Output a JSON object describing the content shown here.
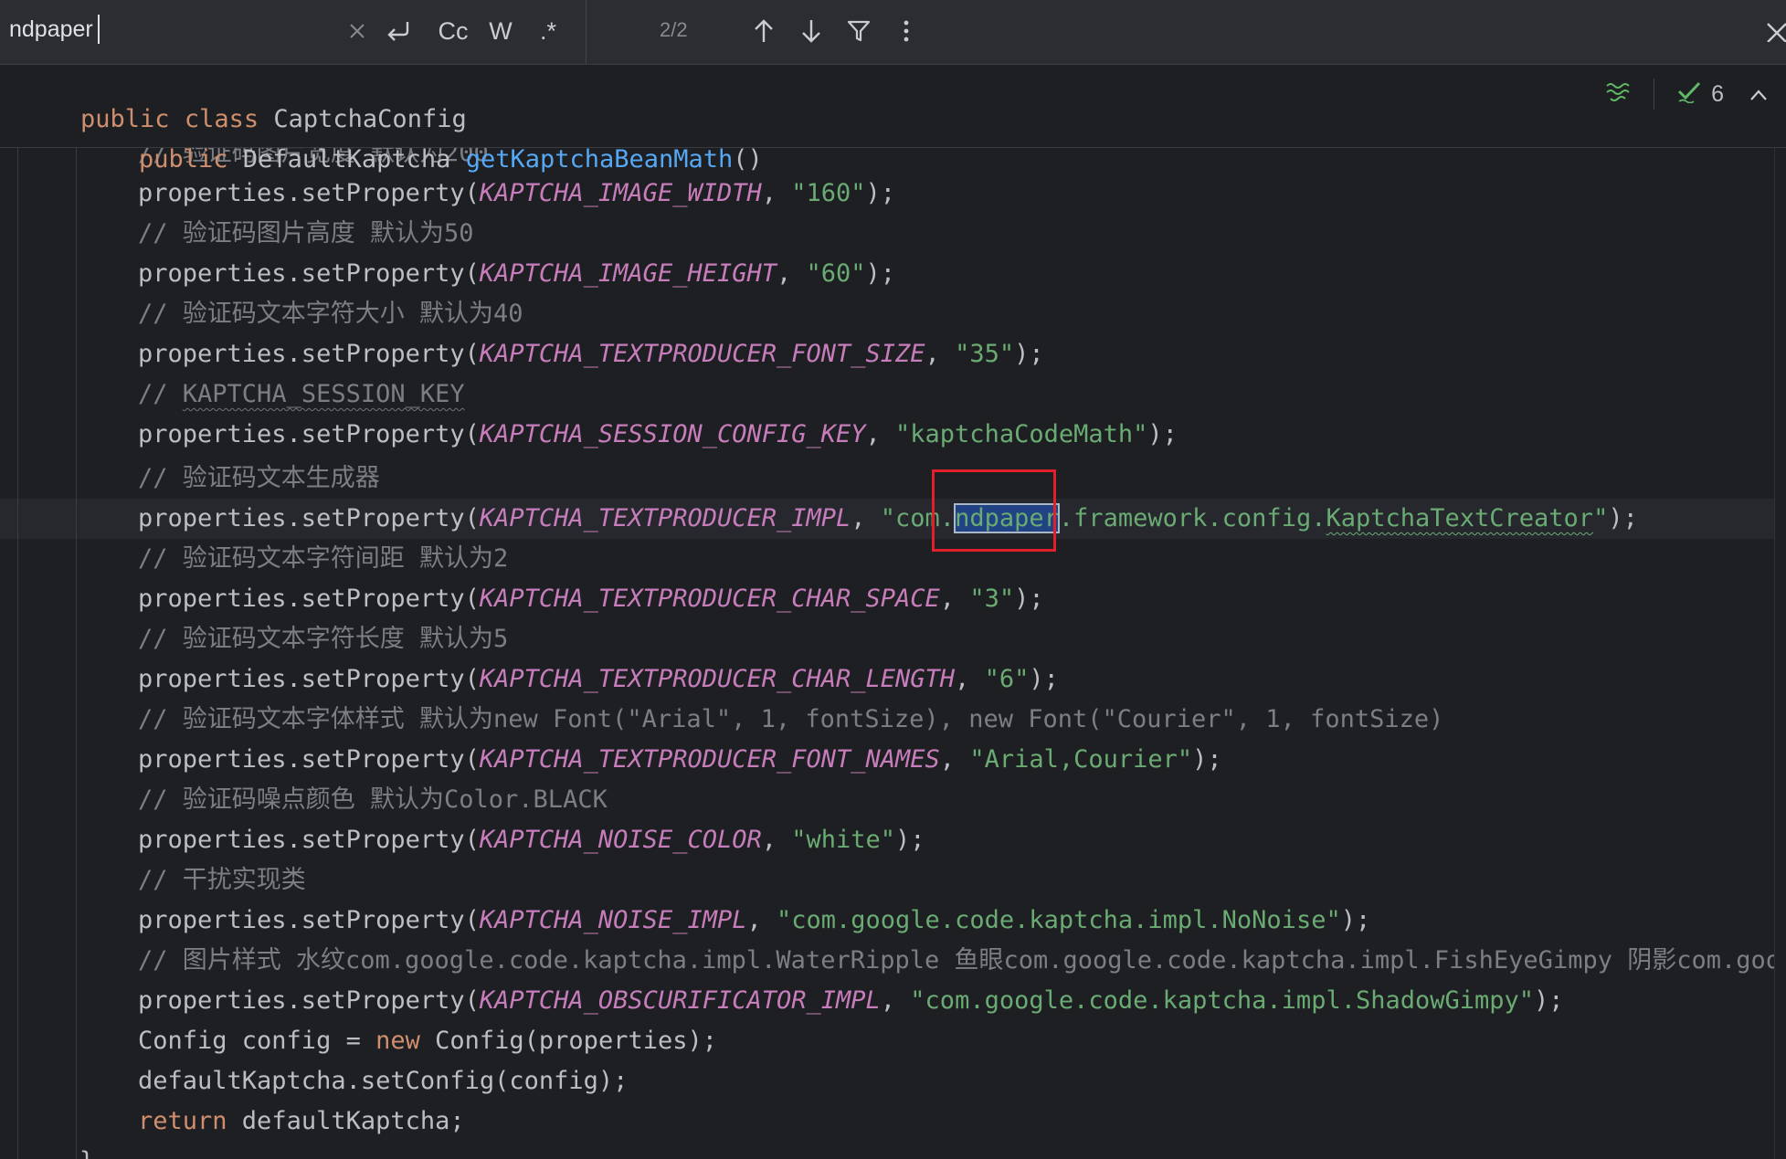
{
  "search": {
    "query": "ndpaper",
    "clear_icon": "close-icon",
    "new_line_icon": "enter-icon",
    "match_case_label": "Cc",
    "words_label": "W",
    "regex_label": ".*",
    "match_count": "2/2",
    "prev_icon": "arrow-up-icon",
    "next_icon": "arrow-down-icon",
    "filter_icon": "filter-icon",
    "more_icon": "more-vertical-icon",
    "close_icon": "close-icon"
  },
  "sticky": {
    "line1": {
      "kw1": "public",
      "kw2": "class",
      "name": "CaptchaConfig"
    },
    "line2": {
      "kw": "public",
      "type": "DefaultKaptcha",
      "method": "getKaptchaBeanMath",
      "parens": "()"
    }
  },
  "inspection": {
    "ok_count": "6",
    "ok_icon": "check-icon",
    "ai_icon": "ai-assistant-icon",
    "collapse_icon": "chevron-up-icon"
  },
  "code": {
    "c1": "// 验证码图片宽度 默认为200",
    "call": "properties.setProperty(",
    "close": ");",
    "comma": ", ",
    "l1_const": "KAPTCHA_IMAGE_WIDTH",
    "l1_val": "\"160\"",
    "c2": "// 验证码图片高度 默认为50",
    "l2_const": "KAPTCHA_IMAGE_HEIGHT",
    "l2_val": "\"60\"",
    "c3": "// 验证码文本字符大小 默认为40",
    "l3_const": "KAPTCHA_TEXTPRODUCER_FONT_SIZE",
    "l3_val": "\"35\"",
    "c4_prefix": "// ",
    "c4_rest": "KAPTCHA_SESSION_KEY",
    "l4_const": "KAPTCHA_SESSION_CONFIG_KEY",
    "l4_val": "\"kaptchaCodeMath\"",
    "c5": "// 验证码文本生成器",
    "l5_const": "KAPTCHA_TEXTPRODUCER_IMPL",
    "l5_val_a": "\"com.",
    "l5_val_match": "ndpaper",
    "l5_val_b": ".framework.config.",
    "l5_val_c": "KaptchaTextCreator",
    "l5_val_d": "\"",
    "c6": "// 验证码文本字符间距 默认为2",
    "l6_const": "KAPTCHA_TEXTPRODUCER_CHAR_SPACE",
    "l6_val": "\"3\"",
    "c7": "// 验证码文本字符长度 默认为5",
    "l7_const": "KAPTCHA_TEXTPRODUCER_CHAR_LENGTH",
    "l7_val": "\"6\"",
    "c8": "// 验证码文本字体样式 默认为new Font(\"Arial\", 1, fontSize), new Font(\"Courier\", 1, fontSize)",
    "l8_const": "KAPTCHA_TEXTPRODUCER_FONT_NAMES",
    "l8_val": "\"Arial,Courier\"",
    "c9": "// 验证码噪点颜色 默认为Color.BLACK",
    "l9_const": "KAPTCHA_NOISE_COLOR",
    "l9_val": "\"white\"",
    "c10": "// 干扰实现类",
    "l10_const": "KAPTCHA_NOISE_IMPL",
    "l10_val": "\"com.google.code.kaptcha.impl.NoNoise\"",
    "c11": "// 图片样式 水纹com.google.code.kaptcha.impl.WaterRipple 鱼眼com.google.code.kaptcha.impl.FishEyeGimpy 阴影com.google",
    "l11_const": "KAPTCHA_OBSCURIFICATOR_IMPL",
    "l11_val": "\"com.google.code.kaptcha.impl.ShadowGimpy\"",
    "l12_a": "Config config = ",
    "l12_kw": "new",
    "l12_b": " Config(properties);",
    "l13": "defaultKaptcha.setConfig(config);",
    "l14_kw": "return",
    "l14_b": " defaultKaptcha;",
    "l15": "}"
  }
}
